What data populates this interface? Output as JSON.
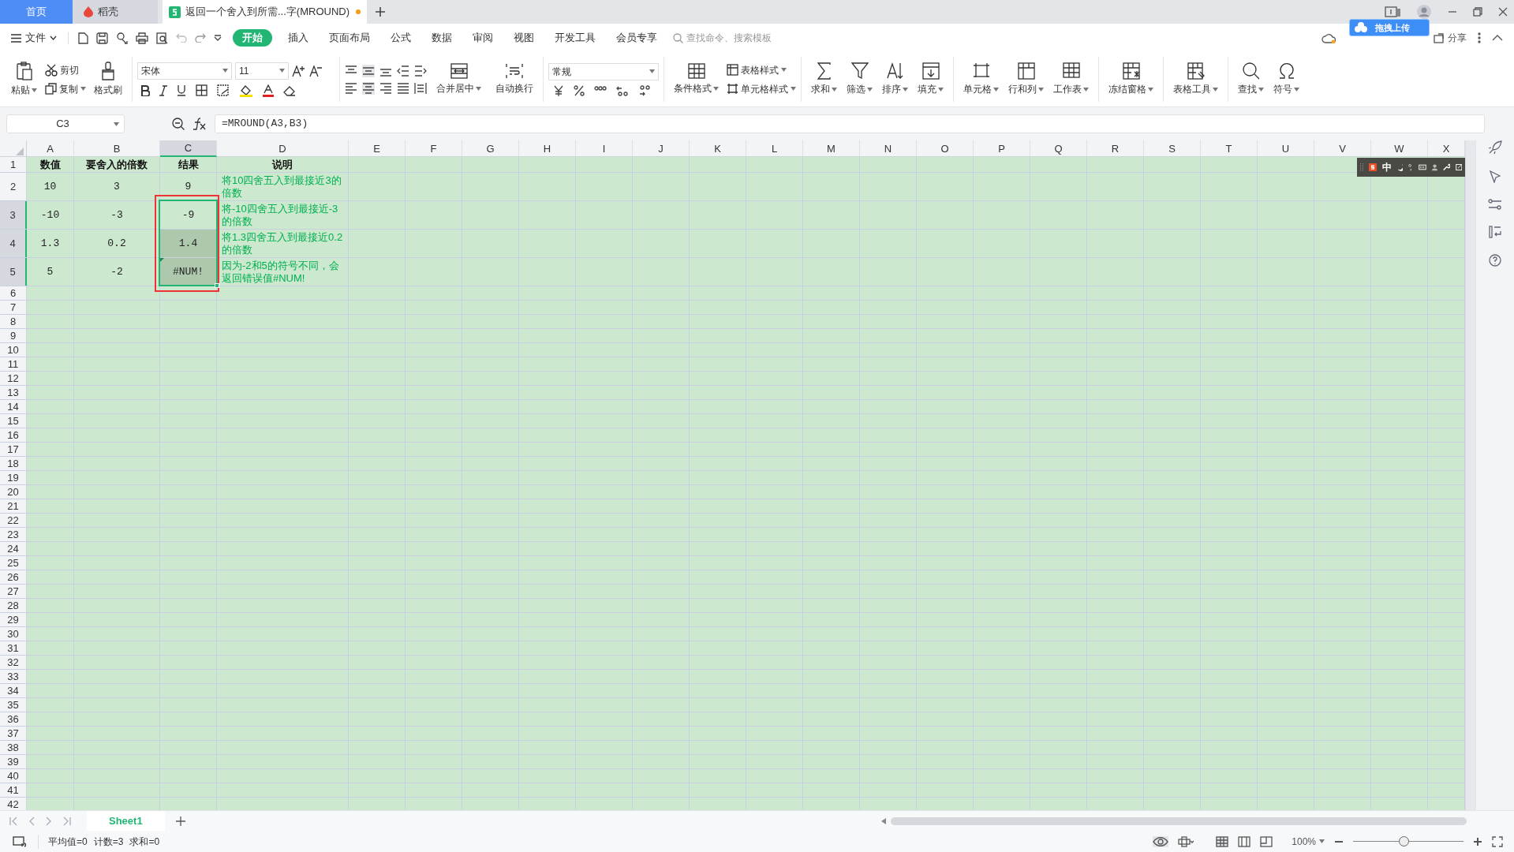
{
  "tabs": [
    {
      "label": "首页",
      "selected": false
    },
    {
      "label": "稻壳",
      "selected": false
    },
    {
      "label": "返回一个舍入到所需...字(MROUND)",
      "selected": true,
      "unsaved": true
    }
  ],
  "menu": {
    "file": "文件",
    "items": [
      {
        "label": "开始",
        "selected": true
      },
      {
        "label": "插入",
        "selected": false
      },
      {
        "label": "页面布局",
        "selected": false
      },
      {
        "label": "公式",
        "selected": false
      },
      {
        "label": "数据",
        "selected": false
      },
      {
        "label": "审阅",
        "selected": false
      },
      {
        "label": "视图",
        "selected": false
      },
      {
        "label": "开发工具",
        "selected": false
      },
      {
        "label": "会员专享",
        "selected": false
      }
    ]
  },
  "search": {
    "placeholder": "查找命令、搜索模板"
  },
  "upload_badge": "拖拽上传",
  "share": "分享",
  "ribbon": {
    "clipboard": [
      "粘贴",
      "剪切",
      "复制",
      "格式刷"
    ],
    "font": {
      "name": "宋体",
      "size": "11"
    },
    "align": [
      "合并居中",
      "自动换行"
    ],
    "number_format": "常规",
    "styles": [
      "条件格式",
      "表格样式",
      "单元格样式"
    ],
    "tools": [
      "求和",
      "筛选",
      "排序",
      "填充",
      "单元格",
      "行和列",
      "工作表",
      "冻结窗格",
      "表格工具",
      "查找",
      "符号"
    ]
  },
  "name_box": "C3",
  "formula": "=MROUND(A3,B3)",
  "grid": {
    "columns": [
      {
        "label": "A",
        "selected": false
      },
      {
        "label": "B",
        "selected": false
      },
      {
        "label": "C",
        "selected": true
      },
      {
        "label": "D",
        "selected": false
      },
      {
        "label": "E",
        "selected": false
      },
      {
        "label": "F",
        "selected": false
      },
      {
        "label": "G",
        "selected": false
      },
      {
        "label": "H",
        "selected": false
      },
      {
        "label": "I",
        "selected": false
      },
      {
        "label": "J",
        "selected": false
      },
      {
        "label": "K",
        "selected": false
      },
      {
        "label": "L",
        "selected": false
      },
      {
        "label": "M",
        "selected": false
      },
      {
        "label": "N",
        "selected": false
      },
      {
        "label": "O",
        "selected": false
      },
      {
        "label": "P",
        "selected": false
      },
      {
        "label": "Q",
        "selected": false
      },
      {
        "label": "R",
        "selected": false
      },
      {
        "label": "S",
        "selected": false
      },
      {
        "label": "T",
        "selected": false
      },
      {
        "label": "U",
        "selected": false
      },
      {
        "label": "V",
        "selected": false
      },
      {
        "label": "W",
        "selected": false
      },
      {
        "label": "X",
        "selected": false
      }
    ],
    "rows": [
      {
        "label": "1",
        "selected": false,
        "cells": [
          {
            "text": "数值",
            "selected": false
          },
          {
            "text": "要舍入的倍数",
            "selected": false
          },
          {
            "text": "结果",
            "selected": false
          },
          {
            "text": "说明",
            "selected": false
          }
        ]
      },
      {
        "label": "2",
        "selected": false,
        "cells": [
          {
            "text": "10",
            "selected": false
          },
          {
            "text": "3",
            "selected": false
          },
          {
            "text": "9",
            "selected": false
          },
          {
            "text": "将10四舍五入到最接近3的倍数",
            "selected": false
          }
        ]
      },
      {
        "label": "3",
        "selected": true,
        "cells": [
          {
            "text": "-10",
            "selected": false
          },
          {
            "text": "-3",
            "selected": false
          },
          {
            "text": "-9",
            "selected": true,
            "active": true
          },
          {
            "text": "将-10四舍五入到最接近-3的倍数",
            "selected": false
          }
        ]
      },
      {
        "label": "4",
        "selected": true,
        "cells": [
          {
            "text": "1.3",
            "selected": false
          },
          {
            "text": "0.2",
            "selected": false
          },
          {
            "text": "1.4",
            "selected": true,
            "active": false
          },
          {
            "text": "将1.3四舍五入到最接近0.2的倍数",
            "selected": false
          }
        ]
      },
      {
        "label": "5",
        "selected": true,
        "cells": [
          {
            "text": "5",
            "selected": false
          },
          {
            "text": "-2",
            "selected": false
          },
          {
            "text": "#NUM!",
            "selected": true,
            "active": false,
            "error_flag": true
          },
          {
            "text": "因为-2和5的符号不同，会返回错误值#NUM!",
            "selected": false
          }
        ]
      },
      {
        "label": "6",
        "selected": false
      },
      {
        "label": "7",
        "selected": false
      },
      {
        "label": "8",
        "selected": false
      },
      {
        "label": "9",
        "selected": false
      },
      {
        "label": "10",
        "selected": false
      },
      {
        "label": "11",
        "selected": false
      },
      {
        "label": "12",
        "selected": false
      },
      {
        "label": "13",
        "selected": false
      },
      {
        "label": "14",
        "selected": false
      },
      {
        "label": "15",
        "selected": false
      },
      {
        "label": "16",
        "selected": false
      },
      {
        "label": "17",
        "selected": false
      },
      {
        "label": "18",
        "selected": false
      },
      {
        "label": "19",
        "selected": false
      },
      {
        "label": "20",
        "selected": false
      },
      {
        "label": "21",
        "selected": false
      },
      {
        "label": "22",
        "selected": false
      },
      {
        "label": "23",
        "selected": false
      },
      {
        "label": "24",
        "selected": false
      },
      {
        "label": "25",
        "selected": false
      },
      {
        "label": "26",
        "selected": false
      },
      {
        "label": "27",
        "selected": false
      },
      {
        "label": "28",
        "selected": false
      },
      {
        "label": "29",
        "selected": false
      },
      {
        "label": "30",
        "selected": false
      },
      {
        "label": "31",
        "selected": false
      },
      {
        "label": "32",
        "selected": false
      },
      {
        "label": "33",
        "selected": false
      },
      {
        "label": "34",
        "selected": false
      },
      {
        "label": "35",
        "selected": false
      },
      {
        "label": "36",
        "selected": false
      },
      {
        "label": "37",
        "selected": false
      },
      {
        "label": "38",
        "selected": false
      },
      {
        "label": "39",
        "selected": false
      },
      {
        "label": "40",
        "selected": false
      },
      {
        "label": "41",
        "selected": false
      },
      {
        "label": "42",
        "selected": false
      }
    ]
  },
  "ime": {
    "mode": "中"
  },
  "sheets": [
    {
      "label": "Sheet1",
      "selected": true
    }
  ],
  "status": [
    "平均值=0",
    "计数=3",
    "求和=0"
  ],
  "zoom": {
    "label": "100%",
    "level": 0.46
  }
}
